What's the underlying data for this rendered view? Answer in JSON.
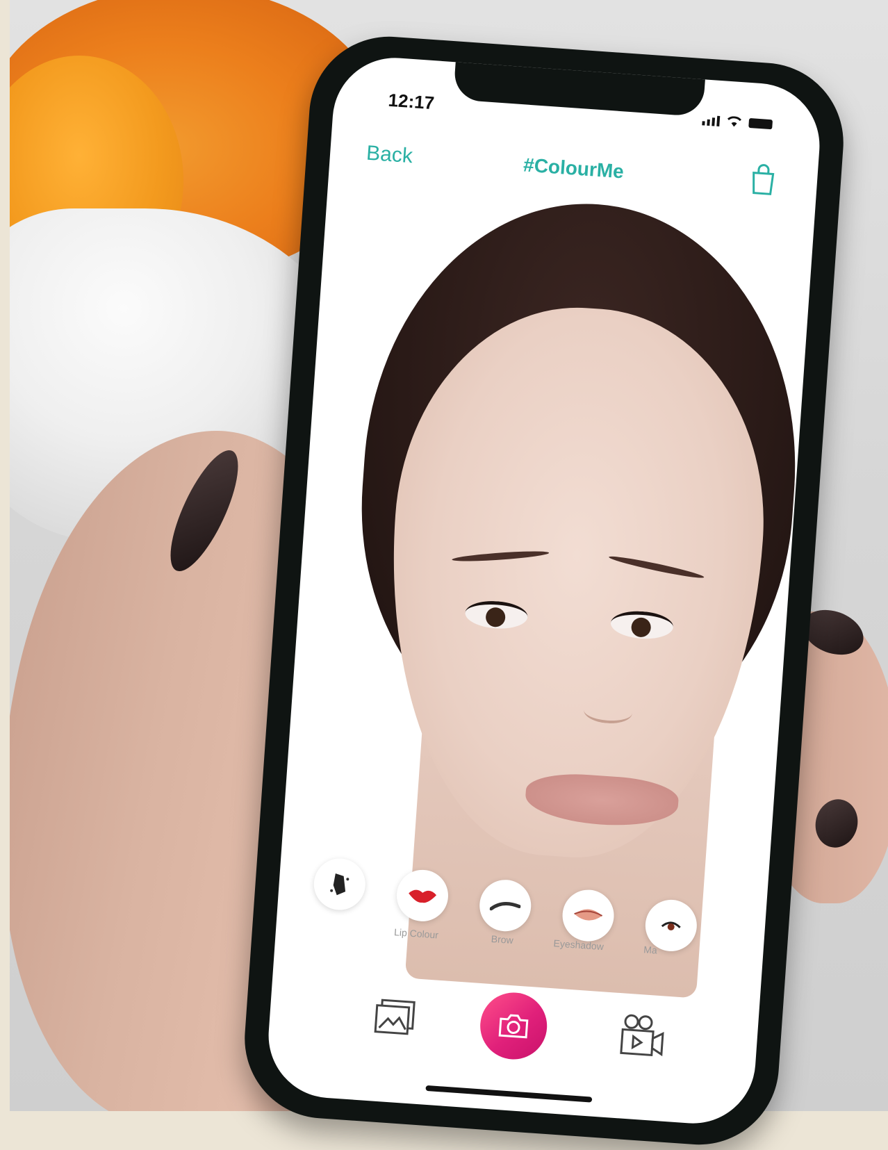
{
  "status_bar": {
    "time": "12:17"
  },
  "nav": {
    "back_label": "Back",
    "title": "#ColourMe"
  },
  "makeup_tools": [
    {
      "icon": "brush-icon",
      "label": ""
    },
    {
      "icon": "lips-icon",
      "label": "Lip Colour"
    },
    {
      "icon": "brow-icon",
      "label": "Brow"
    },
    {
      "icon": "eyeshadow-icon",
      "label": "Eyeshadow"
    },
    {
      "icon": "mascara-icon",
      "label": "Ma"
    }
  ],
  "colors": {
    "accent": "#2ab0a4",
    "shutter": "#e0207a"
  }
}
